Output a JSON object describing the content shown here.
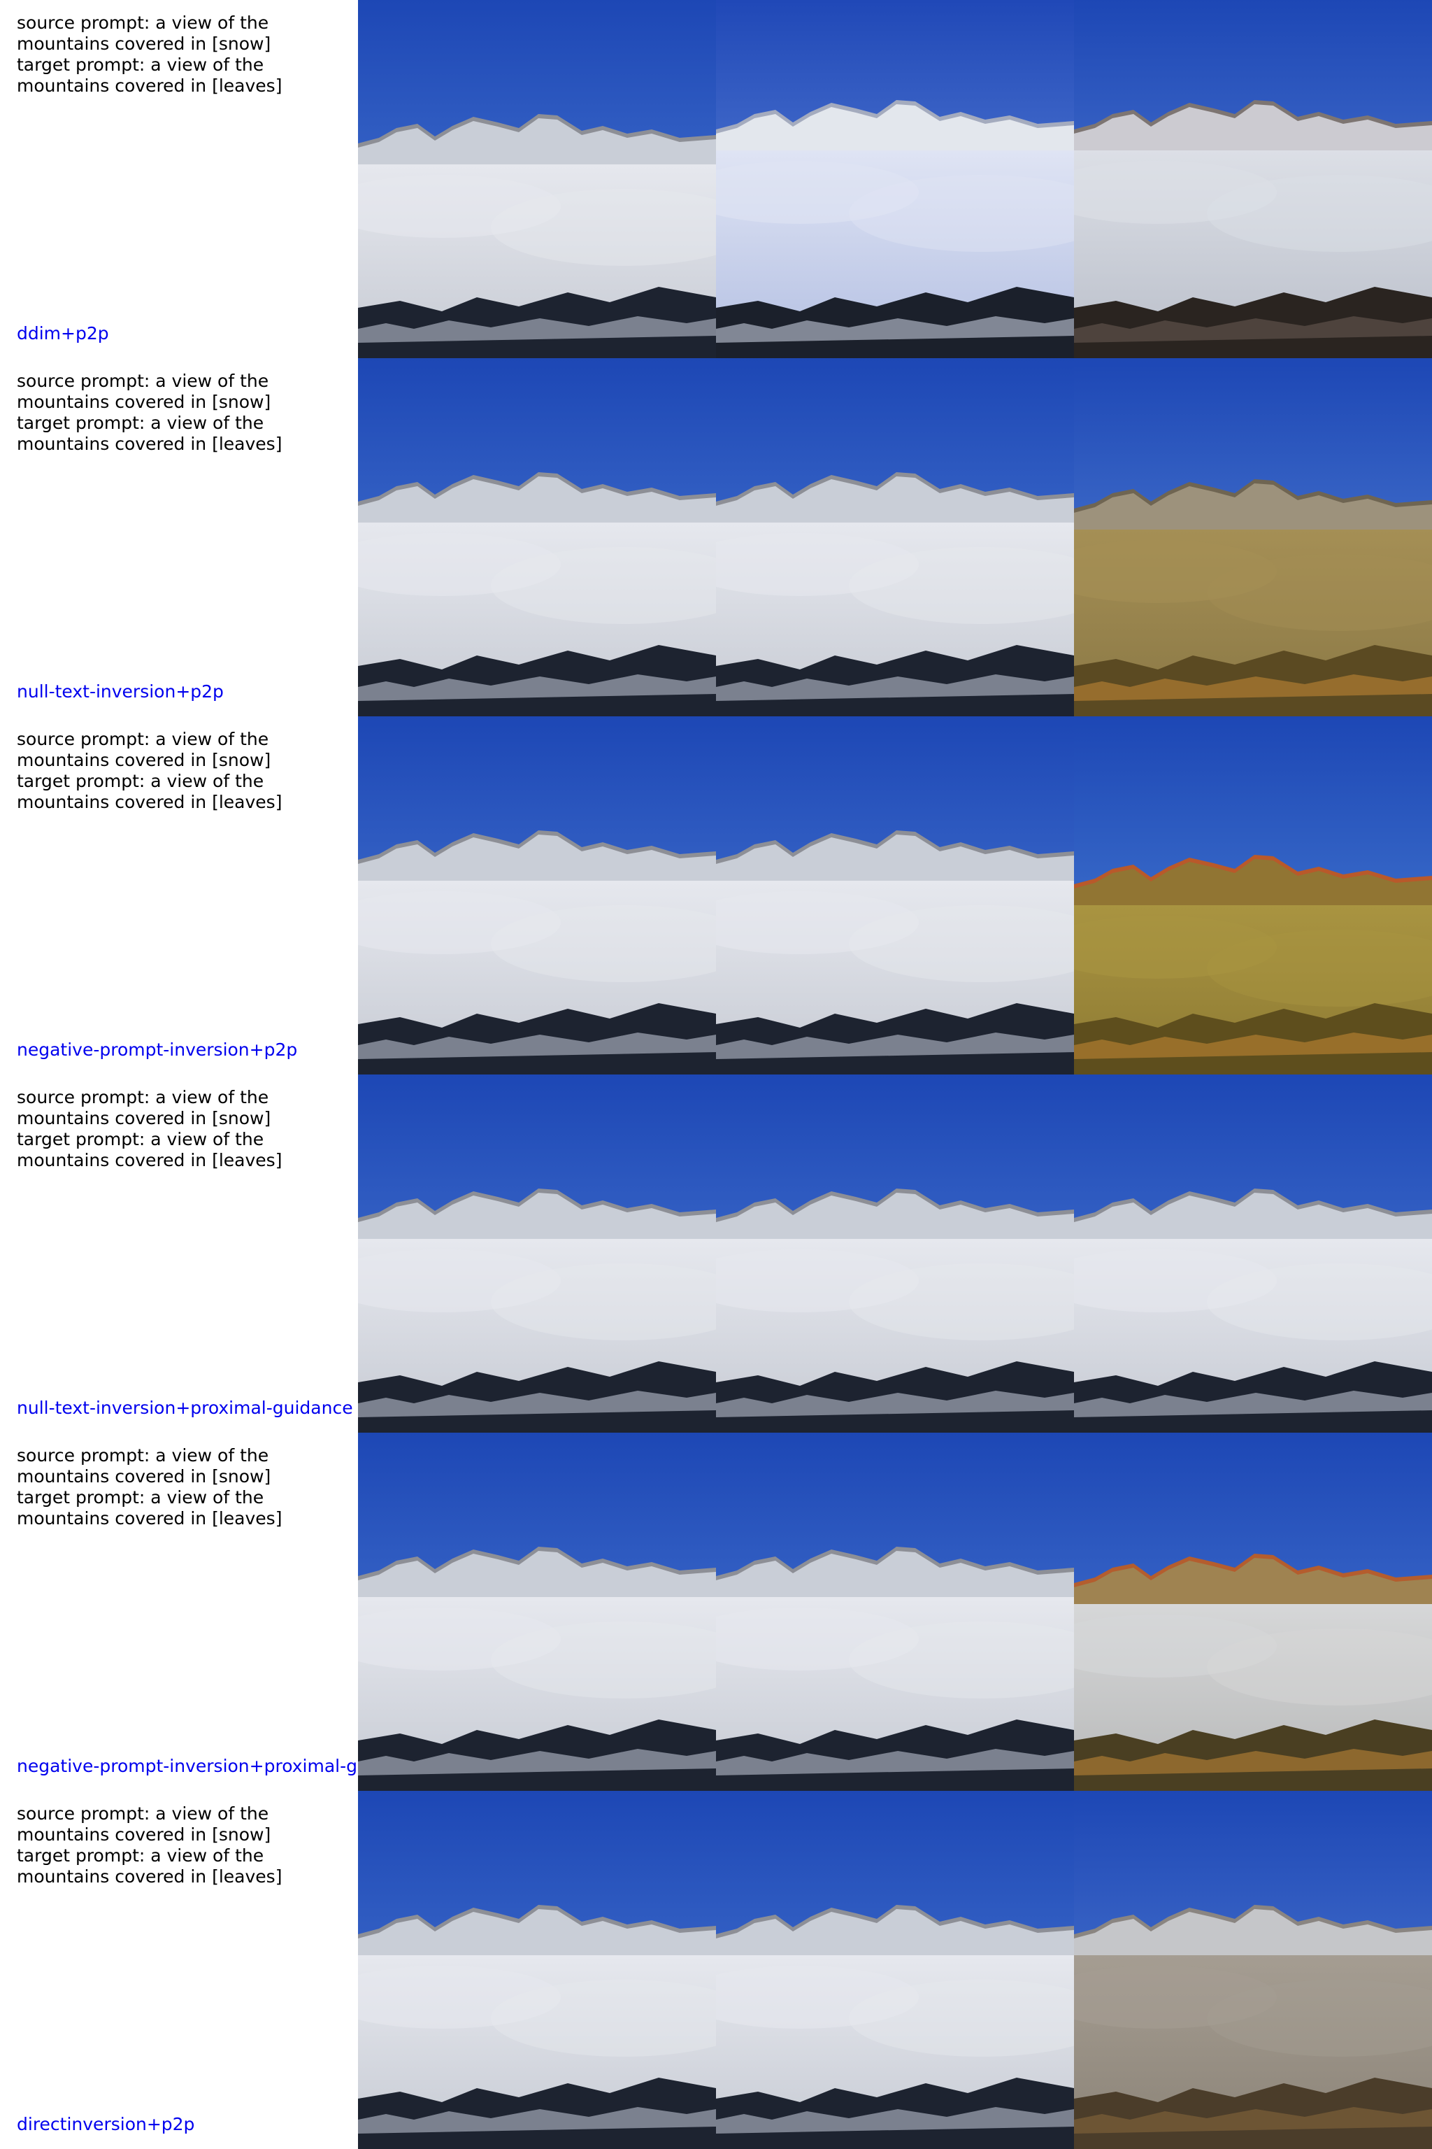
{
  "source_prompt": "source prompt: a view of the\nmountains covered in [snow]",
  "target_prompt": "target prompt: a view of the\nmountains covered in [leaves]",
  "method_color": "#0000ee",
  "rows": [
    {
      "method": "ddim+p2p",
      "panels": [
        "snow-cloud",
        "snow-bright",
        "snow-dark"
      ]
    },
    {
      "method": "null-text-inversion+p2p",
      "panels": [
        "snow-cloud",
        "snow-cloud",
        "autumn-dry"
      ]
    },
    {
      "method": "negative-prompt-inversion+p2p",
      "panels": [
        "snow-cloud",
        "snow-cloud",
        "autumn-meadow"
      ]
    },
    {
      "method": "null-text-inversion+proximal-guidance",
      "panels": [
        "snow-cloud",
        "snow-cloud",
        "snow-cloud"
      ]
    },
    {
      "method": "negative-prompt-inversion+proximal-g",
      "panels": [
        "snow-cloud",
        "snow-cloud",
        "autumn-cloud"
      ]
    },
    {
      "method": "directinversion+p2p",
      "panels": [
        "snow-cloud",
        "snow-cloud",
        "autumn-gray"
      ]
    }
  ]
}
